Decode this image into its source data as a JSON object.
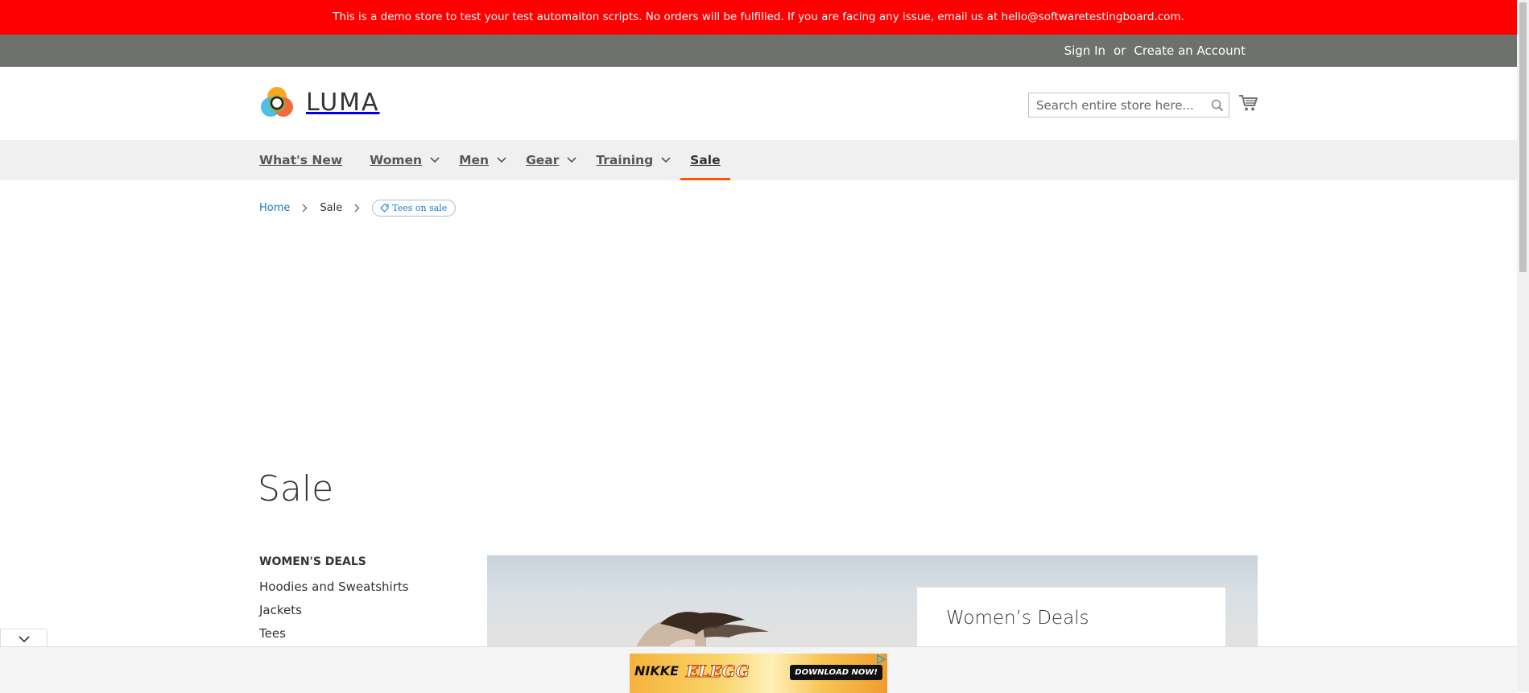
{
  "demo_notice": "This is a demo store to test your test automaiton scripts. No orders will be fulfilled. If you are facing any issue, email us at hello@softwaretestingboard.com.",
  "header": {
    "sign_in": "Sign In",
    "or": "or",
    "create_account": "Create an Account"
  },
  "logo": {
    "text": "LUMA"
  },
  "search": {
    "placeholder": "Search entire store here..."
  },
  "nav": {
    "items": [
      {
        "label": "What's New"
      },
      {
        "label": "Women"
      },
      {
        "label": "Men"
      },
      {
        "label": "Gear"
      },
      {
        "label": "Training"
      },
      {
        "label": "Sale"
      }
    ]
  },
  "breadcrumbs": {
    "home": "Home",
    "sale": "Sale",
    "tag": "Tees on sale"
  },
  "page_title": "Sale",
  "sidebar": {
    "title": "WOMEN'S DEALS",
    "items": [
      "Hoodies and Sweatshirts",
      "Jackets",
      "Tees"
    ]
  },
  "promo": {
    "title": "Women’s Deals"
  },
  "ad": {
    "brand": "NIKKE",
    "logo_text": "ELEGG",
    "cta": "DOWNLOAD NOW!"
  },
  "colors": {
    "notice_bg": "#ff0000",
    "panel_bg": "#6e716e",
    "nav_bg": "#f0f0f0",
    "active_underline": "#ff5501",
    "link": "#1979c3"
  }
}
